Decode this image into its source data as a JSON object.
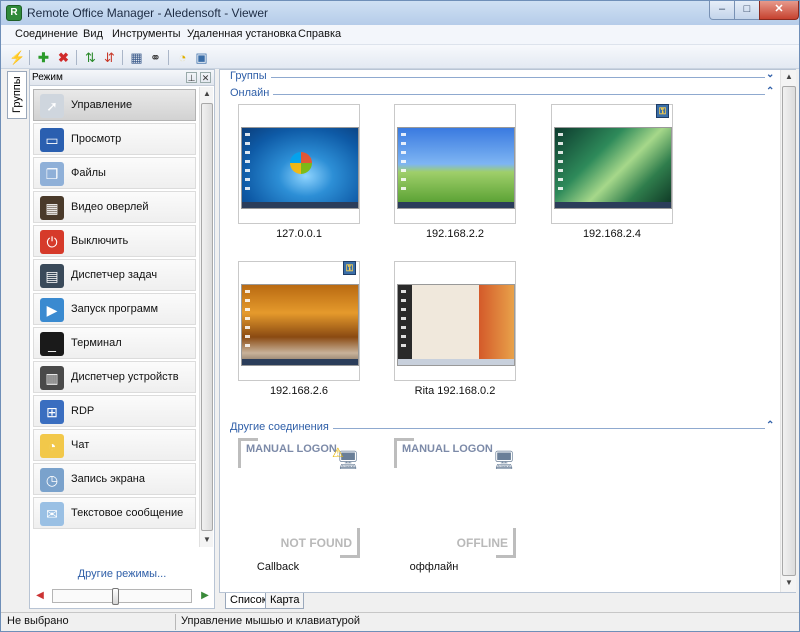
{
  "window": {
    "title": "Remote Office Manager - Aledensoft - Viewer"
  },
  "menu": [
    "Соединение",
    "Вид",
    "Инструменты",
    "Удаленная установка",
    "Справка"
  ],
  "side_tab": "Группы",
  "left_panel": {
    "title": "Режим",
    "modes": [
      {
        "label": "Управление",
        "icon": "mouse-control-icon",
        "color": "#cfd6de",
        "glyph": "➚"
      },
      {
        "label": "Просмотр",
        "icon": "monitor-view-icon",
        "color": "#2a5fb0",
        "glyph": "▭"
      },
      {
        "label": "Файлы",
        "icon": "files-icon",
        "color": "#8fb0d8",
        "glyph": "❐"
      },
      {
        "label": "Видео оверлей",
        "icon": "video-overlay-icon",
        "color": "#4a3a2a",
        "glyph": "▦"
      },
      {
        "label": "Выключить",
        "icon": "power-off-icon",
        "color": "#d63a2a",
        "glyph": "⏻"
      },
      {
        "label": "Диспетчер задач",
        "icon": "task-manager-icon",
        "color": "#3a4a5a",
        "glyph": "▤"
      },
      {
        "label": "Запуск программ",
        "icon": "run-program-icon",
        "color": "#3a8ad0",
        "glyph": "▶"
      },
      {
        "label": "Терминал",
        "icon": "terminal-icon",
        "color": "#1a1a1a",
        "glyph": "_"
      },
      {
        "label": "Диспетчер устройств",
        "icon": "device-manager-icon",
        "color": "#4a4a4a",
        "glyph": "▥"
      },
      {
        "label": "RDP",
        "icon": "rdp-icon",
        "color": "#3a6ec0",
        "glyph": "⊞"
      },
      {
        "label": "Чат",
        "icon": "chat-icon",
        "color": "#f2c84a",
        "glyph": "◔"
      },
      {
        "label": "Запись экрана",
        "icon": "screen-record-icon",
        "color": "#7aa2cc",
        "glyph": "◷"
      },
      {
        "label": "Текстовое сообщение",
        "icon": "text-message-icon",
        "color": "#9ac0e4",
        "glyph": "✉"
      }
    ],
    "other_modes": "Другие режимы...",
    "zoom_level": 0.45
  },
  "main": {
    "groups_title": "Группы",
    "online_title": "Онлайн",
    "other_title": "Другие соединения",
    "online_hosts": [
      {
        "label": "127.0.0.1",
        "screen": "scr-win7",
        "badge": false
      },
      {
        "label": "192.168.2.2",
        "screen": "scr-xp",
        "badge": false
      },
      {
        "label": "192.168.2.4",
        "screen": "scr-vista",
        "badge": true
      },
      {
        "label": "192.168.2.6",
        "screen": "scr-autumn",
        "badge": true
      },
      {
        "label": "Rita 192.168.0.2",
        "screen": "scr-site",
        "badge": false
      }
    ],
    "other_hosts": [
      {
        "logon": "MANUAL LOGON",
        "status": "NOT FOUND",
        "label": "Callback",
        "warning": true
      },
      {
        "logon": "MANUAL LOGON",
        "status": "OFFLINE",
        "label": "оффлайн",
        "warning": false
      }
    ]
  },
  "bottom_tabs": [
    "Список",
    "Карта"
  ],
  "statusbar": {
    "left": "Не выбрано",
    "right": "Управление мышью и клавиатурой"
  }
}
